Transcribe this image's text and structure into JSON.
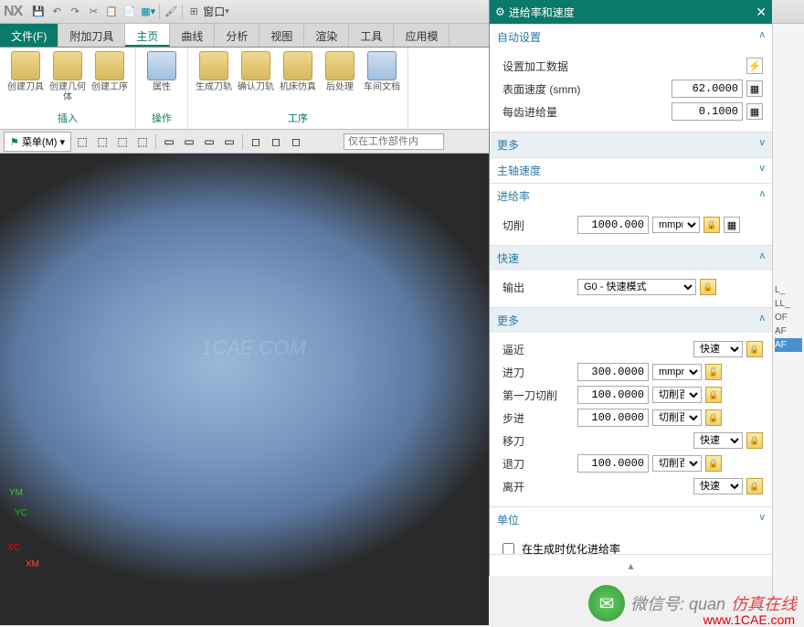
{
  "app": {
    "logo": "NX",
    "window_menu": "窗口"
  },
  "tabs": {
    "file": "文件(F)",
    "items": [
      "附加刀具",
      "主页",
      "曲线",
      "分析",
      "视图",
      "渲染",
      "工具",
      "应用模"
    ]
  },
  "ribbon": {
    "g1": {
      "label": "插入",
      "items": [
        "创建刀具",
        "创建几何体",
        "创建工序"
      ]
    },
    "g2": {
      "label": "操作",
      "items": [
        "属性"
      ]
    },
    "g3": {
      "label": "工序",
      "items": [
        "生成刀轨",
        "确认刀轨",
        "机床仿真",
        "后处理",
        "车间文档"
      ]
    }
  },
  "toolbar2": {
    "menu": "菜单(M)",
    "search_ph": "仅在工作部件内"
  },
  "viewport": {
    "wm": "1CAE.COM",
    "axis_x": "XC",
    "axis_y": "YC",
    "axis_xm": "XM",
    "axis_ym": "YM"
  },
  "dialog": {
    "title": "进给率和速度",
    "auto": {
      "header": "自动设置",
      "set_data": "设置加工数据",
      "surface_speed_lbl": "表面速度 (smm)",
      "surface_speed_val": "62.0000",
      "feed_per_tooth_lbl": "每齿进给量",
      "feed_per_tooth_val": "0.1000",
      "more": "更多"
    },
    "spindle": {
      "header": "主轴速度"
    },
    "feedrate": {
      "header": "进给率",
      "cut_lbl": "切削",
      "cut_val": "1000.000",
      "cut_unit": "mmpm",
      "rapid_hdr": "快速",
      "output_lbl": "输出",
      "output_val": "G0 - 快速模式",
      "more_hdr": "更多",
      "approach_lbl": "逼近",
      "approach_unit": "快速",
      "engage_lbl": "进刀",
      "engage_val": "300.0000",
      "engage_unit": "mmpm",
      "firstcut_lbl": "第一刀切削",
      "firstcut_val": "100.0000",
      "firstcut_unit": "切削百分",
      "step_lbl": "步进",
      "step_val": "100.0000",
      "step_unit": "切削百分",
      "traverse_lbl": "移刀",
      "traverse_unit": "快速",
      "retract_lbl": "退刀",
      "retract_val": "100.0000",
      "retract_unit": "切削百分",
      "depart_lbl": "离开",
      "depart_unit": "快速"
    },
    "units": {
      "header": "单位"
    },
    "optimize_chk": "在生成时优化进给率"
  },
  "rightstrip": [
    "L_",
    "LL_",
    "OF",
    "AF",
    "AF"
  ],
  "footer": {
    "wx_label": "微信号: quan",
    "sim": "仿真在线",
    "url": "www.1CAE.com"
  }
}
